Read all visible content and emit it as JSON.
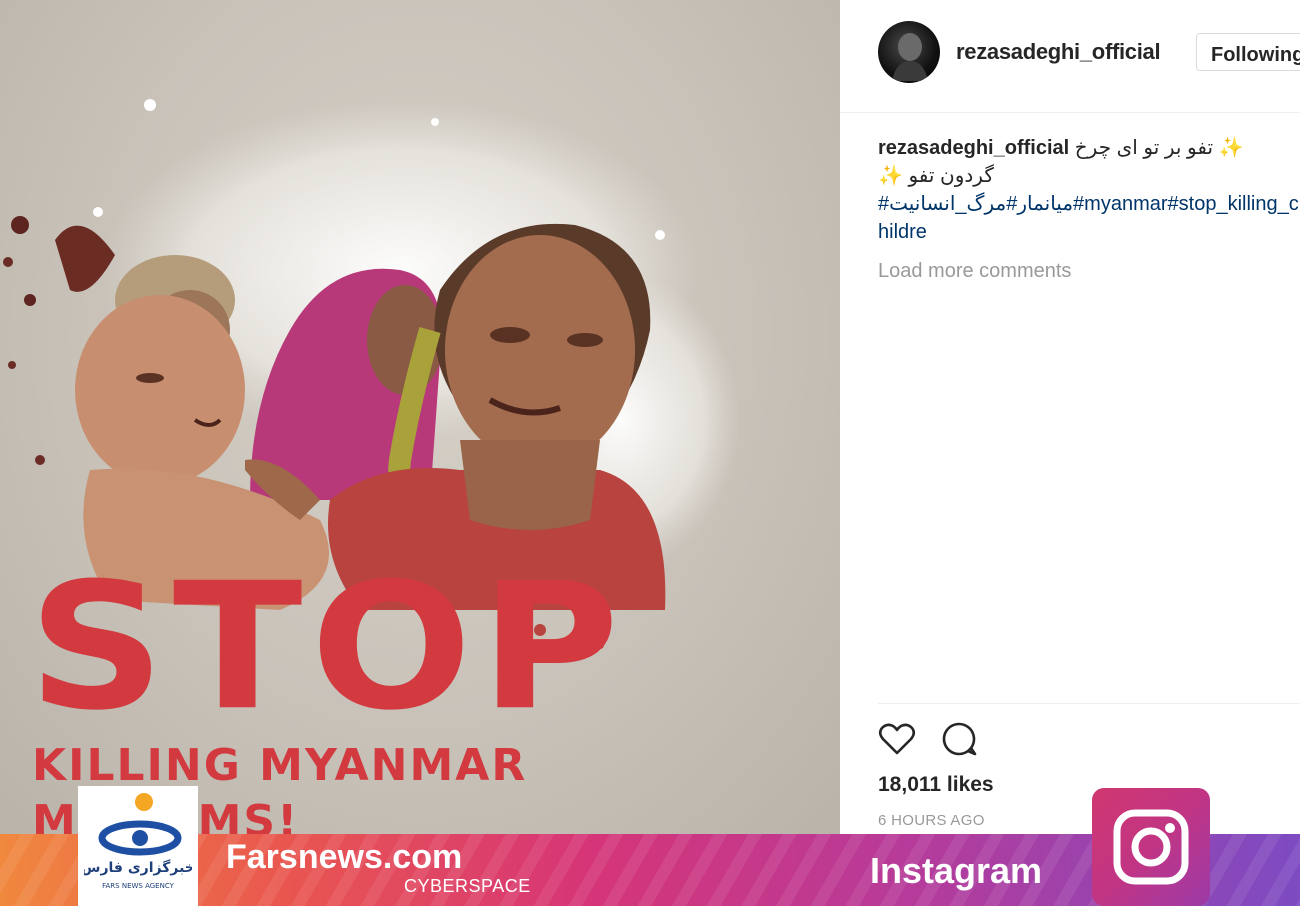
{
  "post": {
    "image_headline": "STOP",
    "image_subline": "KILLING MYANMAR MUSLIMS!"
  },
  "header": {
    "username": "rezasadeghi_official",
    "follow_button": "Following"
  },
  "caption": {
    "username": "rezasadeghi_official",
    "text_line1": "تفو بر تو ای چرخ ✨",
    "text_line2": "✨ گردون تفو",
    "hashtags": "#میانمار#مرگ_انسانیت#myanmar#stop_killing_childre"
  },
  "comments": {
    "load_more": "Load more comments"
  },
  "actions": {
    "likes": "18,011 likes",
    "timestamp": "6 HOURS AGO"
  },
  "banner": {
    "site": "Farsnews.com",
    "section": "CYBERSPACE",
    "platform": "Instagram",
    "agency_logo_text": "خبرگزاری فارس",
    "agency_logo_sub": "FARS NEWS AGENCY"
  },
  "colors": {
    "stop_red": "#d23a3f",
    "hashtag_blue": "#003569",
    "muted_gray": "#999999"
  }
}
